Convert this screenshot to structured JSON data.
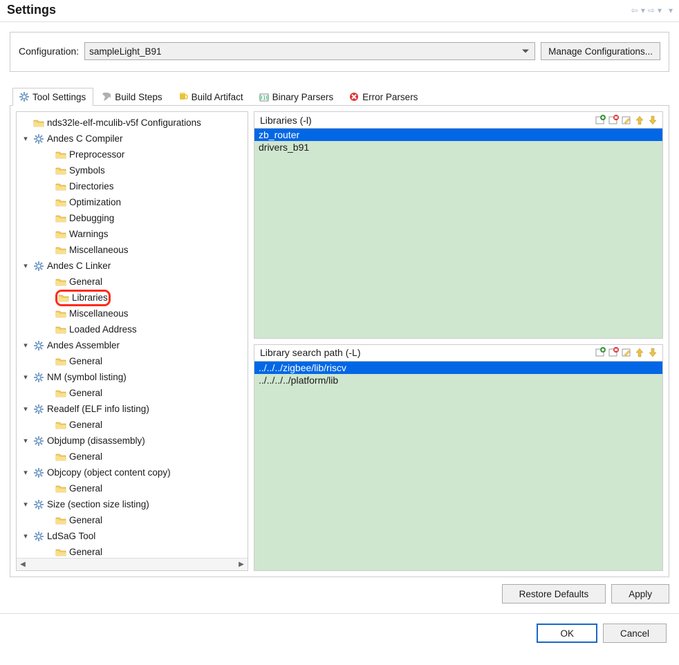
{
  "title": "Settings",
  "configuration": {
    "label": "Configuration:",
    "value": "sampleLight_B91",
    "manage_btn": "Manage Configurations..."
  },
  "tabs": [
    {
      "label": "Tool Settings",
      "active": true
    },
    {
      "label": "Build Steps",
      "active": false
    },
    {
      "label": "Build Artifact",
      "active": false
    },
    {
      "label": "Binary Parsers",
      "active": false
    },
    {
      "label": "Error Parsers",
      "active": false
    }
  ],
  "tree": {
    "root": "nds32le-elf-mculib-v5f Configurations",
    "nodes": [
      {
        "label": "Andes C Compiler",
        "children": [
          "Preprocessor",
          "Symbols",
          "Directories",
          "Optimization",
          "Debugging",
          "Warnings",
          "Miscellaneous"
        ]
      },
      {
        "label": "Andes C Linker",
        "children": [
          "General",
          "Libraries",
          "Miscellaneous",
          "Loaded Address"
        ],
        "selected_child_index": 1,
        "highlight_child_index": 1
      },
      {
        "label": "Andes Assembler",
        "children": [
          "General"
        ]
      },
      {
        "label": "NM (symbol listing)",
        "children": [
          "General"
        ]
      },
      {
        "label": "Readelf (ELF info listing)",
        "children": [
          "General"
        ]
      },
      {
        "label": "Objdump (disassembly)",
        "children": [
          "General"
        ]
      },
      {
        "label": "Objcopy (object content copy)",
        "children": [
          "General"
        ]
      },
      {
        "label": "Size (section size listing)",
        "children": [
          "General"
        ]
      },
      {
        "label": "LdSaG Tool",
        "children": [
          "General"
        ]
      }
    ]
  },
  "libraries_panel": {
    "title": "Libraries (-l)",
    "items": [
      "zb_router",
      "drivers_b91"
    ],
    "selected_index": 0
  },
  "search_panel": {
    "title": "Library search path (-L)",
    "items": [
      "../../../zigbee/lib/riscv",
      "../../../../platform/lib"
    ],
    "selected_index": 0
  },
  "buttons": {
    "restore_defaults": "Restore Defaults",
    "apply": "Apply",
    "ok": "OK",
    "cancel": "Cancel"
  }
}
